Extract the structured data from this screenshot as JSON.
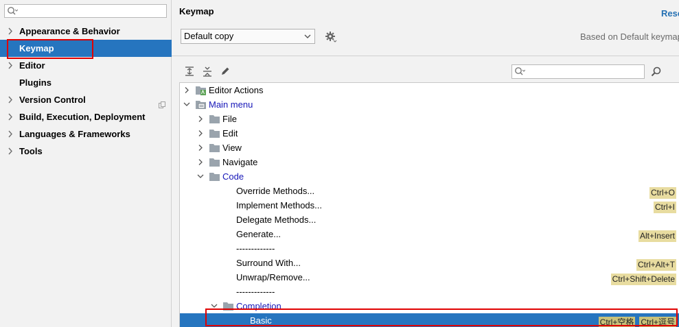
{
  "sidebar": {
    "items": [
      {
        "label": "Appearance & Behavior",
        "expandable": true
      },
      {
        "label": "Keymap",
        "expandable": false
      },
      {
        "label": "Editor",
        "expandable": true
      },
      {
        "label": "Plugins",
        "expandable": false
      },
      {
        "label": "Version Control",
        "expandable": true
      },
      {
        "label": "Build, Execution, Deployment",
        "expandable": true
      },
      {
        "label": "Languages & Frameworks",
        "expandable": true
      },
      {
        "label": "Tools",
        "expandable": true
      }
    ],
    "selected": "Keymap"
  },
  "header": {
    "title": "Keymap",
    "reset_label": "Reset",
    "scheme_value": "Default copy",
    "based_on": "Based on Default keymap"
  },
  "tree": {
    "rows": [
      {
        "label": "Editor Actions",
        "expanded": false
      },
      {
        "label": "Main menu",
        "expanded": true
      },
      {
        "label": "File",
        "expanded": false
      },
      {
        "label": "Edit",
        "expanded": false
      },
      {
        "label": "View",
        "expanded": false
      },
      {
        "label": "Navigate",
        "expanded": false
      },
      {
        "label": "Code",
        "expanded": true
      },
      {
        "label": "Override Methods...",
        "shortcuts": [
          "Ctrl+O"
        ]
      },
      {
        "label": "Implement Methods...",
        "shortcuts": [
          "Ctrl+I"
        ]
      },
      {
        "label": "Delegate Methods...",
        "shortcuts": []
      },
      {
        "label": "Generate...",
        "shortcuts": [
          "Alt+Insert"
        ]
      },
      {
        "label": "-------------",
        "shortcuts": []
      },
      {
        "label": "Surround With...",
        "shortcuts": [
          "Ctrl+Alt+T"
        ]
      },
      {
        "label": "Unwrap/Remove...",
        "shortcuts": [
          "Ctrl+Shift+Delete"
        ]
      },
      {
        "label": "-------------",
        "shortcuts": []
      },
      {
        "label": "Completion",
        "expanded": true
      },
      {
        "label": "Basic",
        "shortcuts": [
          "Ctrl+空格",
          "Ctrl+逗号"
        ]
      }
    ],
    "selected_row": "Basic"
  },
  "colors": {
    "selection": "#2675bf",
    "highlight_box": "#e00000",
    "link_text": "#1515b8",
    "shortcut_badge": "#e8dca0"
  }
}
